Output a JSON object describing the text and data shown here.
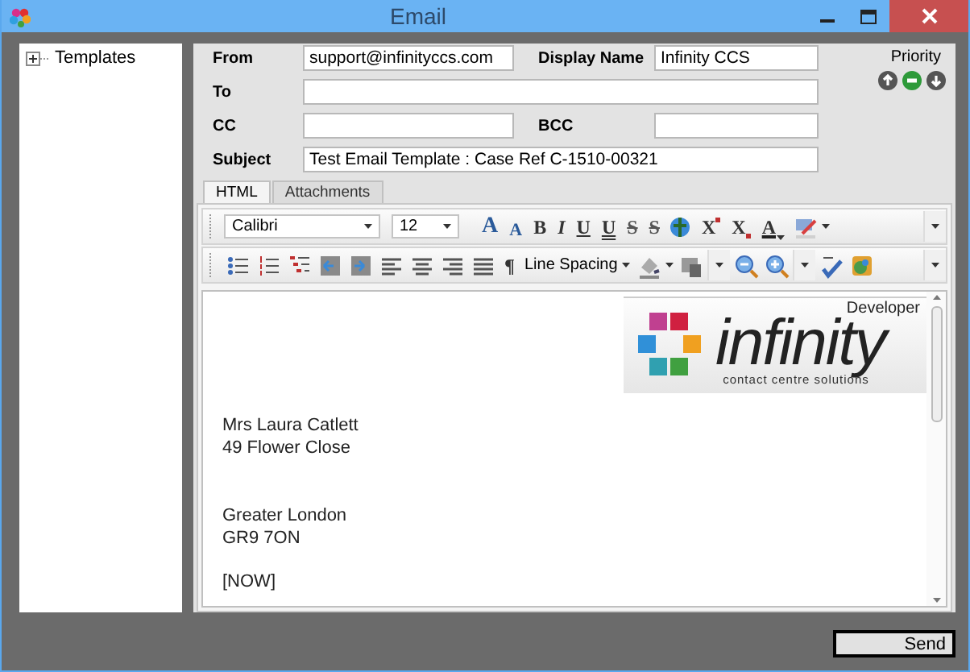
{
  "window": {
    "title": "Email"
  },
  "tree": {
    "items": [
      {
        "label": "Templates",
        "expanded": false
      }
    ]
  },
  "header": {
    "from": {
      "label": "From",
      "value": "support@infinityccs.com"
    },
    "display_name": {
      "label": "Display Name",
      "value": "Infinity CCS"
    },
    "to": {
      "label": "To"
    },
    "cc": {
      "label": "CC"
    },
    "bcc": {
      "label": "BCC"
    },
    "subject": {
      "label": "Subject",
      "value": "Test Email Template : Case Ref C-1510-00321"
    }
  },
  "priority": {
    "label": "Priority",
    "options": [
      {
        "kind": "up",
        "selected": false
      },
      {
        "kind": "normal",
        "selected": true
      },
      {
        "kind": "down",
        "selected": false
      }
    ]
  },
  "tabs": [
    {
      "label": "HTML",
      "selected": true
    },
    {
      "label": "Attachments",
      "selected": false
    }
  ],
  "toolbar_rows": [
    {
      "items": [
        {
          "kind": "combo",
          "value": "Calibri"
        },
        {
          "kind": "combo",
          "value": "12"
        },
        {
          "kind": "grow",
          "label": "A"
        },
        {
          "kind": "shrink",
          "label": "A"
        },
        {
          "kind": "bold",
          "label": "B"
        },
        {
          "kind": "italic",
          "label": "I"
        },
        {
          "kind": "underline",
          "label": "U"
        },
        {
          "kind": "doubleunderline",
          "label": "U"
        },
        {
          "kind": "strike",
          "label": "S"
        },
        {
          "kind": "doublestrike",
          "label": "S"
        },
        {
          "kind": "hyperlink"
        },
        {
          "kind": "superscript",
          "label": "X"
        },
        {
          "kind": "subscript",
          "label": "X"
        },
        {
          "kind": "color",
          "label": "A"
        },
        {
          "kind": "highlight"
        },
        {
          "kind": "more"
        }
      ]
    },
    {
      "items": [
        {
          "kind": "bullets"
        },
        {
          "kind": "numbering"
        },
        {
          "kind": "multilevel"
        },
        {
          "kind": "outdent"
        },
        {
          "kind": "indent"
        },
        {
          "kind": "alignleft"
        },
        {
          "kind": "aligncenter"
        },
        {
          "kind": "alignright"
        },
        {
          "kind": "justify"
        },
        {
          "kind": "pilcrow",
          "label": "¶"
        },
        {
          "kind": "menu",
          "label": "Line Spacing"
        },
        {
          "kind": "shading"
        },
        {
          "kind": "table"
        },
        {
          "kind": "more"
        },
        {
          "kind": "zoomout"
        },
        {
          "kind": "zoomin"
        },
        {
          "kind": "more"
        },
        {
          "kind": "spellcheck"
        },
        {
          "kind": "image"
        },
        {
          "kind": "more"
        }
      ]
    }
  ],
  "editor": {
    "logo": {
      "caption": "Developer",
      "name": "infinity",
      "tagline": "contact centre solutions"
    },
    "paragraphs": [
      {
        "lines": [
          "Mrs Laura Catlett",
          "49 Flower Close"
        ]
      },
      {
        "lines": [
          "Greater London",
          "GR9 7ON"
        ]
      },
      {
        "lines": [
          "[NOW]"
        ]
      }
    ]
  },
  "buttons": [
    {
      "label": "Send"
    }
  ]
}
